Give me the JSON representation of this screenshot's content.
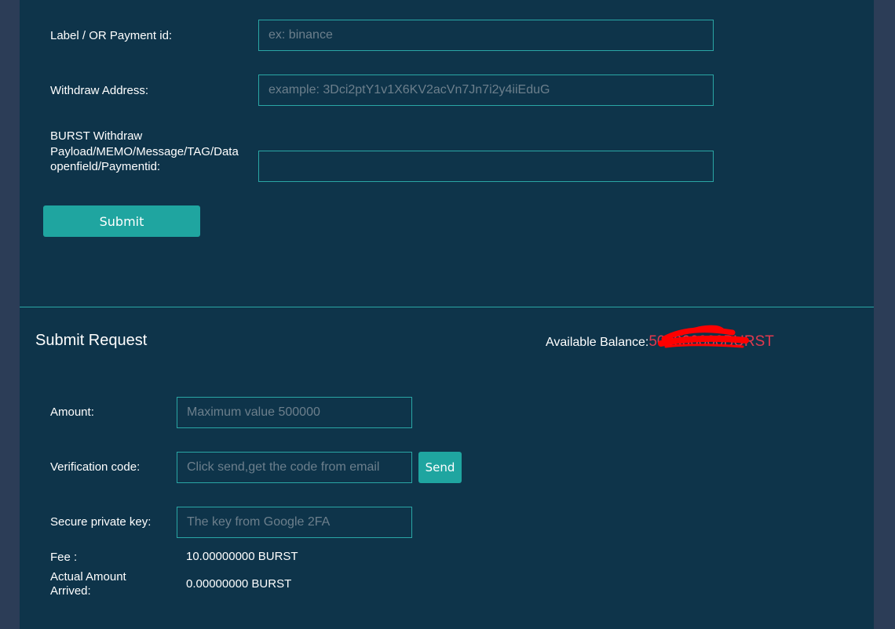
{
  "form": {
    "label_label": "Label / OR Payment id:",
    "label_placeholder": "ex: binance",
    "address_label": "Withdraw Address:",
    "address_placeholder": "example: 3Dci2ptY1v1X6KV2acVn7Jn7i2y4iiEduG",
    "memo_label": "BURST Withdraw Payload/MEMO/Message/TAG/Data openfield/Paymentid:",
    "memo_value": "",
    "submit_label": "Submit"
  },
  "request": {
    "title": "Submit Request",
    "balance_label": "Available Balance:",
    "balance_value": "500000000BURST",
    "amount_label": "Amount:",
    "amount_placeholder": "Maximum value 500000",
    "code_label": "Verification code:",
    "code_placeholder": "Click send,get the code from email",
    "send_label": "Send",
    "key_label": "Secure private key:",
    "key_placeholder": "The key from Google 2FA",
    "fee_label": "Fee :",
    "fee_value": "10.00000000 BURST",
    "arrived_label": "Actual Amount Arrived:",
    "arrived_value": "0.00000000 BURST"
  },
  "colors": {
    "page_bg": "#2c3d57",
    "panel_bg": "#0e344a",
    "accent": "#1fa5a0",
    "balance": "#e0394e",
    "redaction": "#ff0000"
  }
}
